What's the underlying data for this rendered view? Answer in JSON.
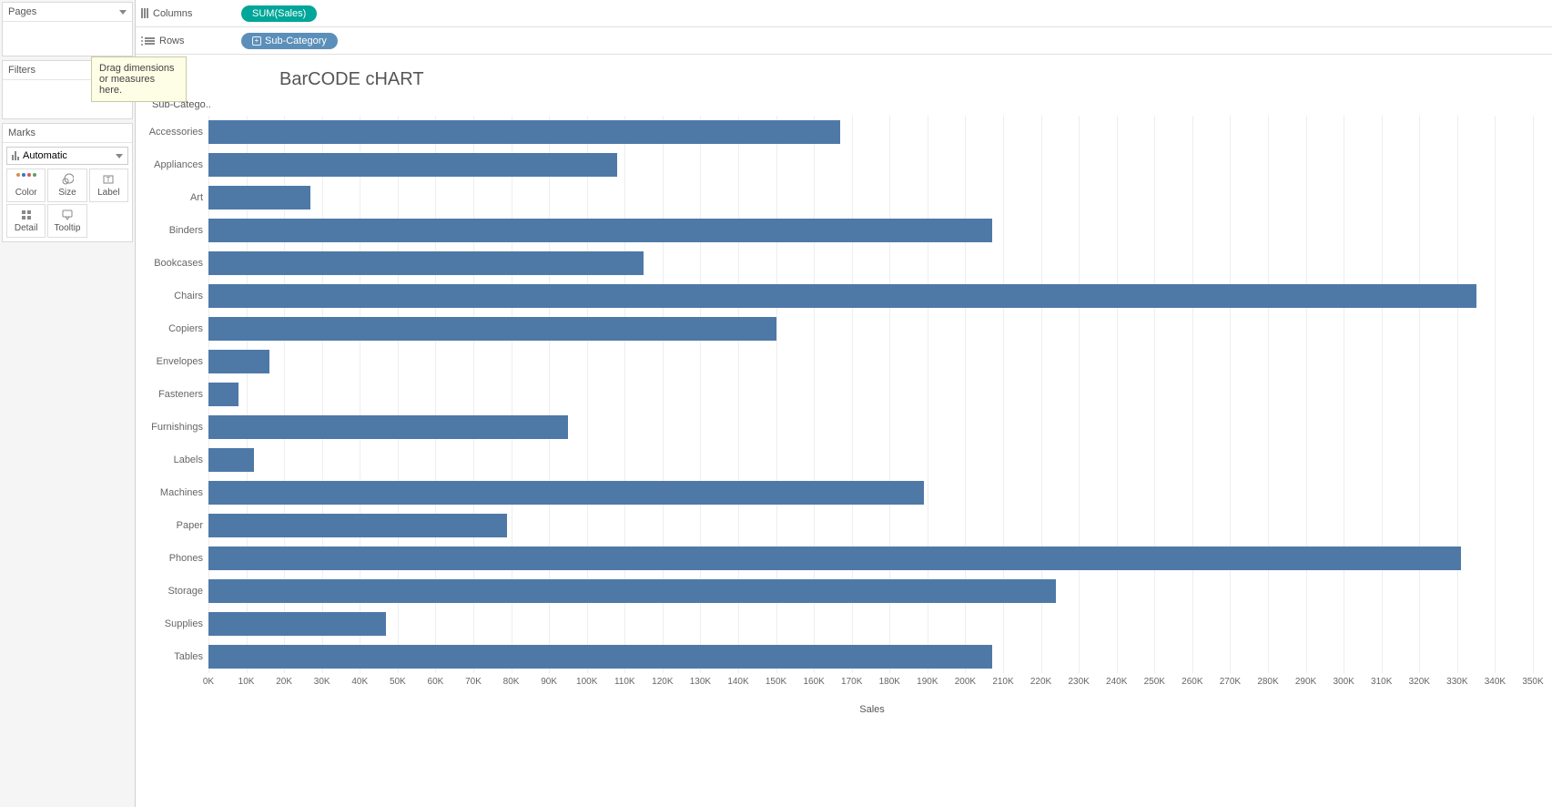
{
  "left": {
    "pages_label": "Pages",
    "filters_label": "Filters",
    "marks_label": "Marks",
    "marktype": "Automatic",
    "buttons": {
      "color": "Color",
      "size": "Size",
      "label": "Label",
      "detail": "Detail",
      "tooltip": "Tooltip"
    }
  },
  "shelves": {
    "columns_label": "Columns",
    "rows_label": "Rows",
    "column_pill": "SUM(Sales)",
    "row_pill": "Sub-Category"
  },
  "tooltip": {
    "line1": "Drag dimensions",
    "line2": "or measures here."
  },
  "viz": {
    "title": "BarCODE cHART",
    "row_header": "Sub-Catego..",
    "xlabel": "Sales"
  },
  "chart_data": {
    "type": "bar",
    "orientation": "horizontal",
    "categories": [
      "Accessories",
      "Appliances",
      "Art",
      "Binders",
      "Bookcases",
      "Chairs",
      "Copiers",
      "Envelopes",
      "Fasteners",
      "Furnishings",
      "Labels",
      "Machines",
      "Paper",
      "Phones",
      "Storage",
      "Supplies",
      "Tables"
    ],
    "values": [
      167000,
      108000,
      27000,
      207000,
      115000,
      335000,
      150000,
      16000,
      8000,
      95000,
      12000,
      189000,
      79000,
      331000,
      224000,
      47000,
      207000
    ],
    "title": "BarCODE cHART",
    "xlabel": "Sales",
    "ylabel": "Sub-Category",
    "xlim": [
      0,
      350000
    ],
    "x_ticks": [
      "0K",
      "10K",
      "20K",
      "30K",
      "40K",
      "50K",
      "60K",
      "70K",
      "80K",
      "90K",
      "100K",
      "110K",
      "120K",
      "130K",
      "140K",
      "150K",
      "160K",
      "170K",
      "180K",
      "190K",
      "200K",
      "210K",
      "220K",
      "230K",
      "240K",
      "250K",
      "260K",
      "270K",
      "280K",
      "290K",
      "300K",
      "310K",
      "320K",
      "330K",
      "340K",
      "350K"
    ]
  }
}
